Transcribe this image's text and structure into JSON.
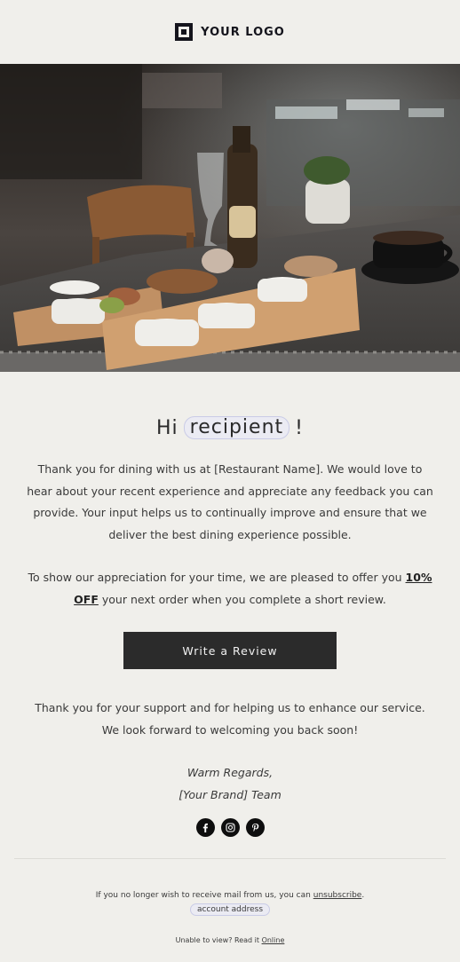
{
  "header": {
    "logo_text": "YOUR LOGO"
  },
  "hero": {
    "image_icon": "restaurant-table-photo"
  },
  "greeting": {
    "prefix": "Hi",
    "merge_tag": "recipient",
    "suffix": "!"
  },
  "body": {
    "paragraph1": "Thank you for dining with us at [Restaurant Name]. We would love to hear about your recent experience and appreciate any feedback you can provide. Your input helps us to continually improve and ensure that we deliver the best dining experience possible.",
    "paragraph2_before": "To show our appreciation for your time, we are pleased to offer you",
    "offer_text": "10% OFF",
    "paragraph2_after": "your next order when you complete a short review.",
    "cta_label": "Write a Review",
    "paragraph3": "Thank you for your support and for helping us to enhance our service. We look forward to welcoming you back soon!",
    "sign_line1": "Warm Regards,",
    "sign_line2": "[Your Brand] Team"
  },
  "social": [
    {
      "icon": "facebook-icon"
    },
    {
      "icon": "instagram-icon"
    },
    {
      "icon": "pinterest-icon"
    }
  ],
  "footer": {
    "unsubscribe_prefix": "If you no longer wish to receive mail from us, you can",
    "unsubscribe_link": "unsubscribe",
    "unsubscribe_suffix": ".",
    "account_address": "account address",
    "online_prefix": "Unable to view? Read it",
    "online_link": "Online"
  },
  "colors": {
    "background": "#f0efeb",
    "button": "#2b2b2b",
    "merge_tag_border": "#c9cbe6",
    "logo": "#14141c"
  }
}
